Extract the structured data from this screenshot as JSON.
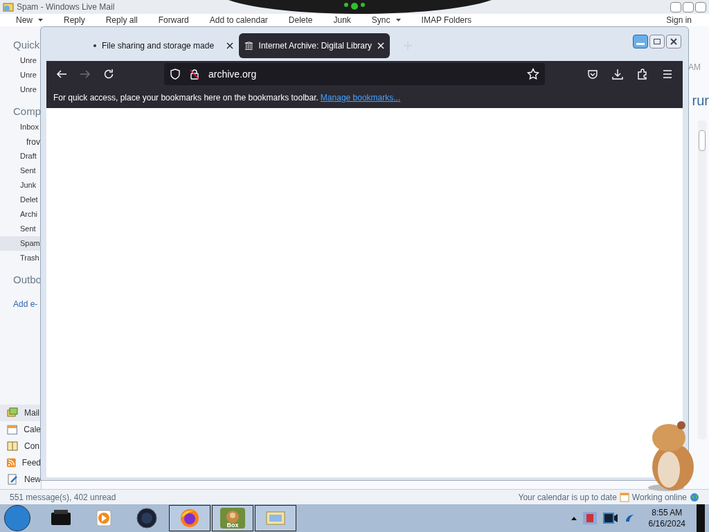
{
  "mail_window": {
    "title": "Spam - Windows Live Mail",
    "toolbar": [
      {
        "label": "New",
        "dropdown": true
      },
      {
        "label": "Reply",
        "dropdown": false
      },
      {
        "label": "Reply all",
        "dropdown": false
      },
      {
        "label": "Forward",
        "dropdown": false
      },
      {
        "label": "Add to calendar",
        "dropdown": false
      },
      {
        "label": "Delete",
        "dropdown": false
      },
      {
        "label": "Junk",
        "dropdown": false
      },
      {
        "label": "Sync",
        "dropdown": true
      },
      {
        "label": "IMAP Folders",
        "dropdown": false
      }
    ],
    "sign_in": "Sign in",
    "sidebar": [
      {
        "heading": "Quick",
        "items": [
          {
            "label": "Unre",
            "selected": false
          },
          {
            "label": "Unre",
            "selected": false
          },
          {
            "label": "Unre",
            "selected": false
          }
        ]
      },
      {
        "heading": "Comp",
        "items": [
          {
            "label": "Inbox",
            "selected": false,
            "children": [
              {
                "label": "frov",
                "selected": false
              }
            ]
          },
          {
            "label": "Draft",
            "selected": false
          },
          {
            "label": "Sent",
            "selected": false
          },
          {
            "label": "Junk",
            "selected": false
          },
          {
            "label": "Delet",
            "selected": false
          },
          {
            "label": "Archi",
            "selected": false
          },
          {
            "label": "Sent",
            "selected": false
          },
          {
            "label": "Spam",
            "selected": true
          },
          {
            "label": "Trash",
            "selected": false
          }
        ]
      },
      {
        "heading": "Outbo"
      }
    ],
    "add_account": "Add e-",
    "nav": [
      {
        "kind": "mail",
        "label": "Mail",
        "selected": true
      },
      {
        "kind": "calendar",
        "label": "Cale",
        "selected": false
      },
      {
        "kind": "contacts",
        "label": "Con",
        "selected": false
      },
      {
        "kind": "feeds",
        "label": "Feed",
        "selected": false
      },
      {
        "kind": "newsgroups",
        "label": "New",
        "selected": false
      }
    ],
    "right_peek": [
      "AM",
      "rur"
    ],
    "status": {
      "left": "551 message(s), 402 unread",
      "calendar": "Your calendar is up to date",
      "online": "Working online"
    }
  },
  "browser": {
    "tabs": [
      {
        "title": "File sharing and storage made",
        "selected": false,
        "dot": true
      },
      {
        "title": "Internet Archive: Digital Library",
        "selected": true,
        "dot": false
      }
    ],
    "url": "archive.org",
    "forward_disabled": true,
    "bookmarks_hint": "For quick access, place your bookmarks here on the bookmarks toolbar.",
    "bookmarks_link": "Manage bookmarks..."
  },
  "taskbar": {
    "items": [
      {
        "kind": "printer",
        "open": false
      },
      {
        "kind": "media",
        "open": false
      },
      {
        "kind": "orb",
        "open": false
      },
      {
        "kind": "firefox",
        "open": true
      },
      {
        "kind": "box",
        "open": true,
        "label": "Box"
      },
      {
        "kind": "mail",
        "open": true
      }
    ],
    "time": "8:55 AM",
    "date": "6/16/2024"
  }
}
